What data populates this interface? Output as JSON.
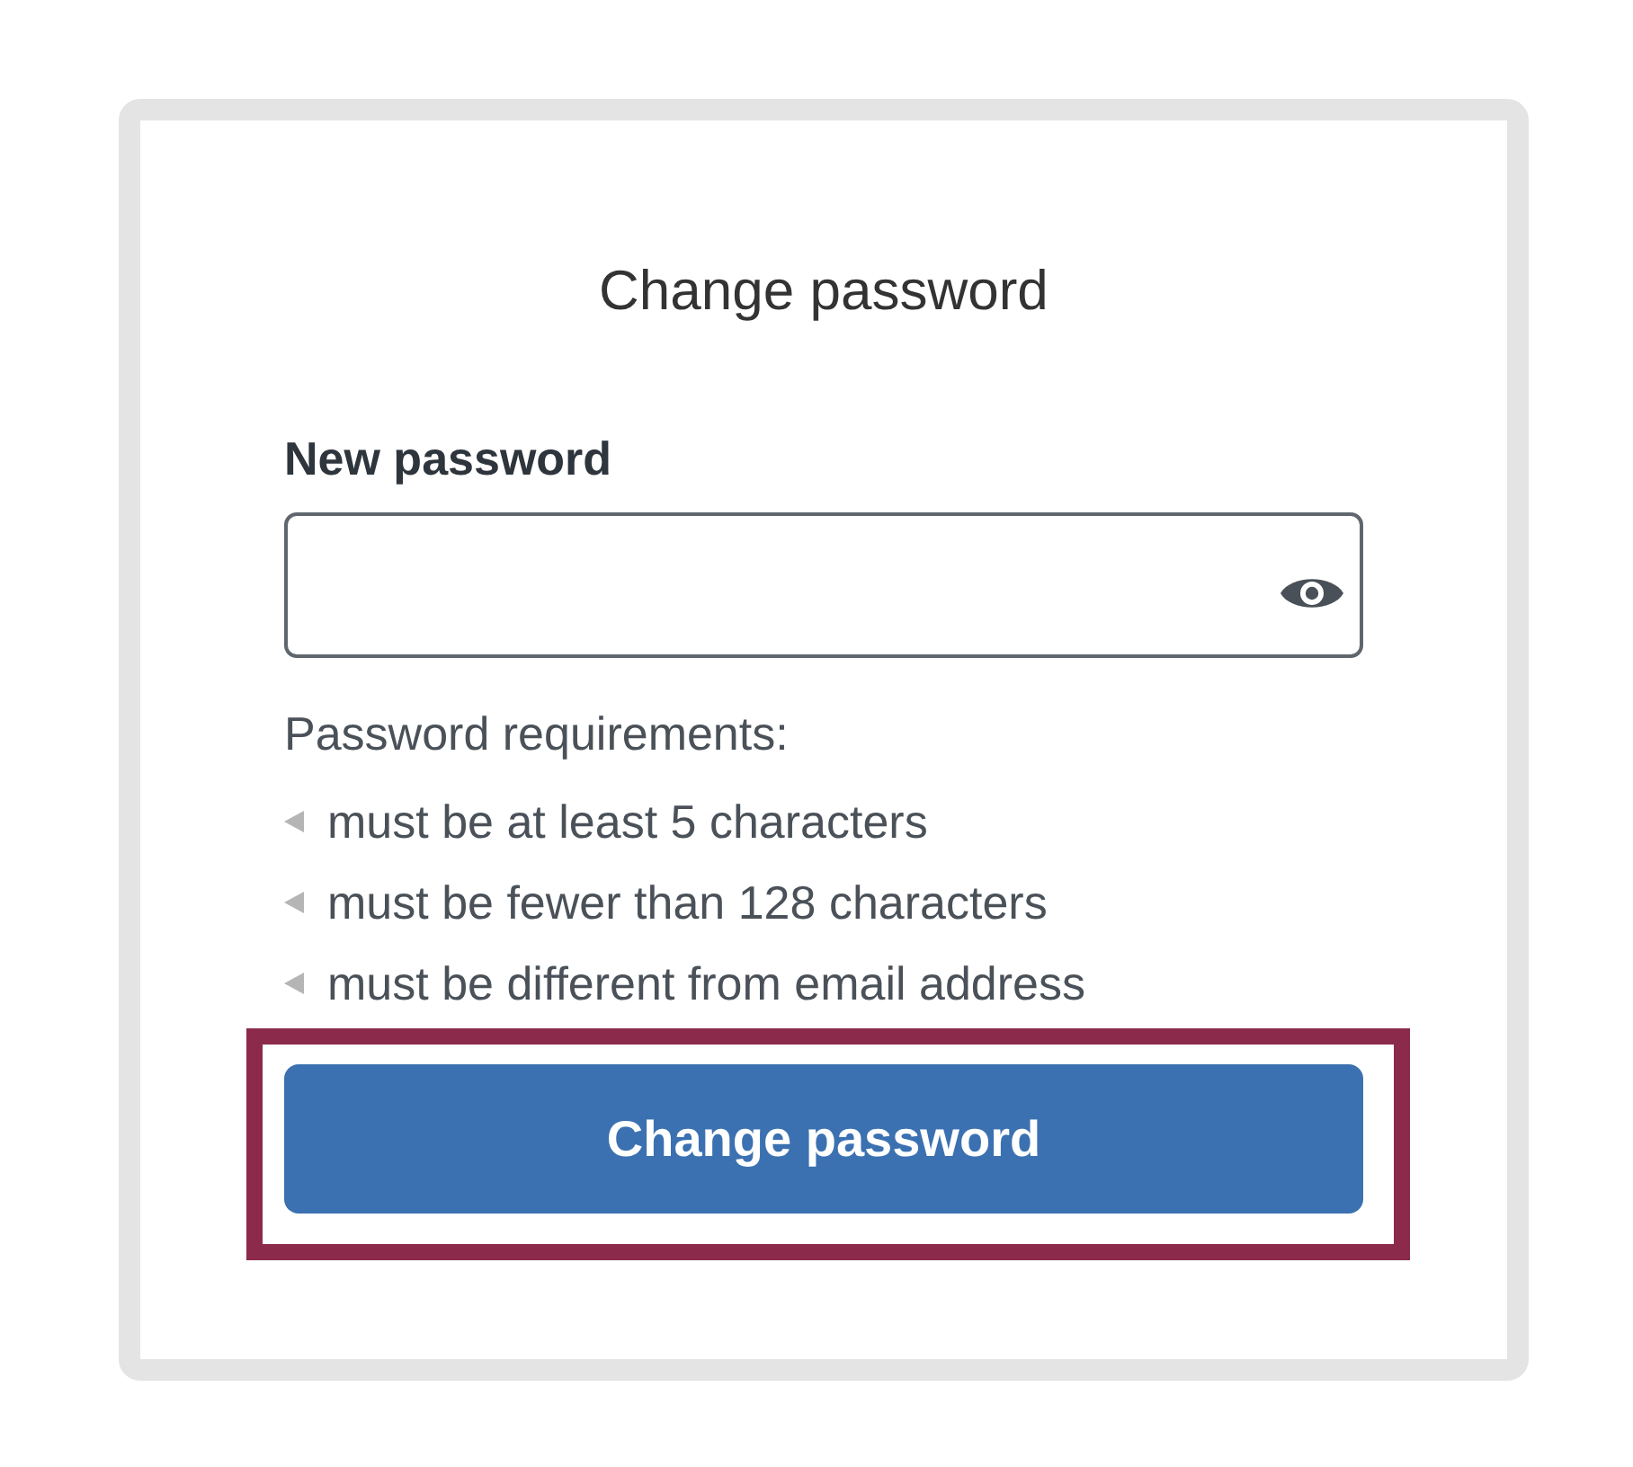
{
  "title": "Change password",
  "password_field": {
    "label": "New password",
    "reveal_toggle": true
  },
  "requirements": {
    "heading": "Password requirements:",
    "items": [
      "must be at least 5 characters",
      "must be fewer than 128 characters",
      "must be different from email address"
    ]
  },
  "submit_button": {
    "label": "Change password",
    "highlighted": true
  }
}
